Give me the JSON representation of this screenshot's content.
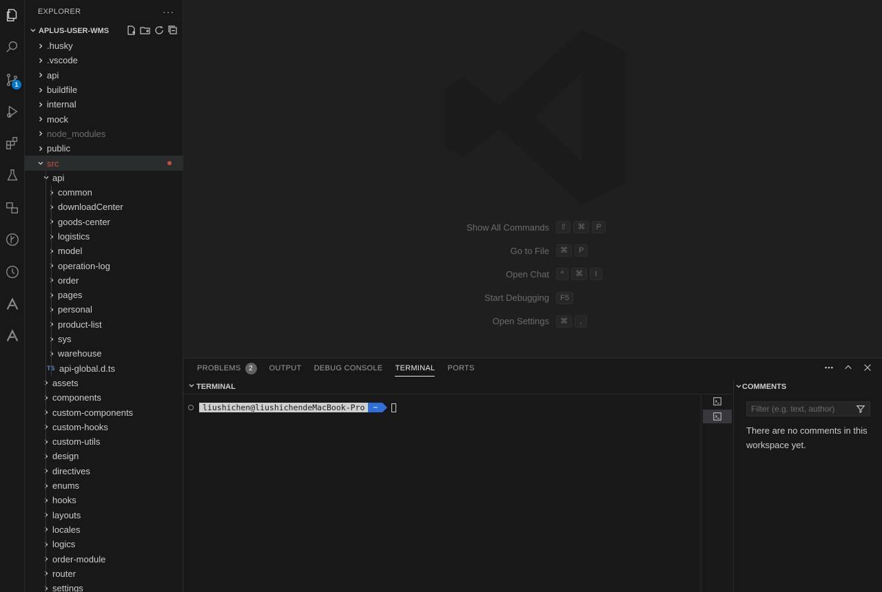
{
  "activity_bar": {
    "icons": [
      "files-icon",
      "search-icon",
      "source-control-icon",
      "run-debug-icon",
      "extensions-icon",
      "testing-icon",
      "remote-explorer-icon",
      "git-graph-icon",
      "timeline-icon",
      "brand-a-icon",
      "brand-a2-icon"
    ],
    "source_control_badge": "1"
  },
  "explorer": {
    "title": "EXPLORER",
    "more": "···",
    "workspace": "APLUS-USER-WMS",
    "items": [
      {
        "label": ".husky",
        "depth": 0,
        "expanded": false
      },
      {
        "label": ".vscode",
        "depth": 0,
        "expanded": false
      },
      {
        "label": "api",
        "depth": 0,
        "expanded": false
      },
      {
        "label": "buildfile",
        "depth": 0,
        "expanded": false
      },
      {
        "label": "internal",
        "depth": 0,
        "expanded": false
      },
      {
        "label": "mock",
        "depth": 0,
        "expanded": false
      },
      {
        "label": "node_modules",
        "depth": 0,
        "expanded": false,
        "dim": true
      },
      {
        "label": "public",
        "depth": 0,
        "expanded": false
      },
      {
        "label": "src",
        "depth": 0,
        "expanded": true,
        "selected": true,
        "modified": true
      },
      {
        "label": "api",
        "depth": 1,
        "expanded": true
      },
      {
        "label": "common",
        "depth": 2,
        "expanded": false
      },
      {
        "label": "downloadCenter",
        "depth": 2,
        "expanded": false
      },
      {
        "label": "goods-center",
        "depth": 2,
        "expanded": false
      },
      {
        "label": "logistics",
        "depth": 2,
        "expanded": false
      },
      {
        "label": "model",
        "depth": 2,
        "expanded": false
      },
      {
        "label": "operation-log",
        "depth": 2,
        "expanded": false
      },
      {
        "label": "order",
        "depth": 2,
        "expanded": false
      },
      {
        "label": "pages",
        "depth": 2,
        "expanded": false
      },
      {
        "label": "personal",
        "depth": 2,
        "expanded": false
      },
      {
        "label": "product-list",
        "depth": 2,
        "expanded": false
      },
      {
        "label": "sys",
        "depth": 2,
        "expanded": false
      },
      {
        "label": "warehouse",
        "depth": 2,
        "expanded": false
      },
      {
        "label": "api-global.d.ts",
        "depth": 2,
        "file": true,
        "file_badge": "TS"
      },
      {
        "label": "assets",
        "depth": 1,
        "expanded": false
      },
      {
        "label": "components",
        "depth": 1,
        "expanded": false
      },
      {
        "label": "custom-components",
        "depth": 1,
        "expanded": false
      },
      {
        "label": "custom-hooks",
        "depth": 1,
        "expanded": false
      },
      {
        "label": "custom-utils",
        "depth": 1,
        "expanded": false
      },
      {
        "label": "design",
        "depth": 1,
        "expanded": false
      },
      {
        "label": "directives",
        "depth": 1,
        "expanded": false
      },
      {
        "label": "enums",
        "depth": 1,
        "expanded": false
      },
      {
        "label": "hooks",
        "depth": 1,
        "expanded": false
      },
      {
        "label": "layouts",
        "depth": 1,
        "expanded": false
      },
      {
        "label": "locales",
        "depth": 1,
        "expanded": false
      },
      {
        "label": "logics",
        "depth": 1,
        "expanded": false
      },
      {
        "label": "order-module",
        "depth": 1,
        "expanded": false
      },
      {
        "label": "router",
        "depth": 1,
        "expanded": false
      },
      {
        "label": "settings",
        "depth": 1,
        "expanded": false
      }
    ]
  },
  "editor_shortcuts": [
    {
      "label": "Show All Commands",
      "keys": [
        "⇧",
        "⌘",
        "P"
      ]
    },
    {
      "label": "Go to File",
      "keys": [
        "⌘",
        "P"
      ]
    },
    {
      "label": "Open Chat",
      "keys": [
        "^",
        "⌘",
        "I"
      ]
    },
    {
      "label": "Start Debugging",
      "keys": [
        "F5"
      ]
    },
    {
      "label": "Open Settings",
      "keys": [
        "⌘",
        ","
      ]
    }
  ],
  "panel": {
    "tabs": [
      {
        "label": "PROBLEMS",
        "count": "2",
        "active": false
      },
      {
        "label": "OUTPUT",
        "active": false
      },
      {
        "label": "DEBUG CONSOLE",
        "active": false
      },
      {
        "label": "TERMINAL",
        "active": true
      },
      {
        "label": "PORTS",
        "active": false
      }
    ],
    "terminal_header": "TERMINAL",
    "prompt_user": "liushichen@liushichendeMacBook-Pro",
    "prompt_dir": "~",
    "comments_header": "COMMENTS",
    "comments_filter_placeholder": "Filter (e.g. text, author)",
    "comments_empty": "There are no comments in this workspace yet."
  },
  "colors": {
    "accent": "#0078d4",
    "selected_folder": "#c74e39",
    "prompt_dir_bg": "#2e6fd8"
  }
}
